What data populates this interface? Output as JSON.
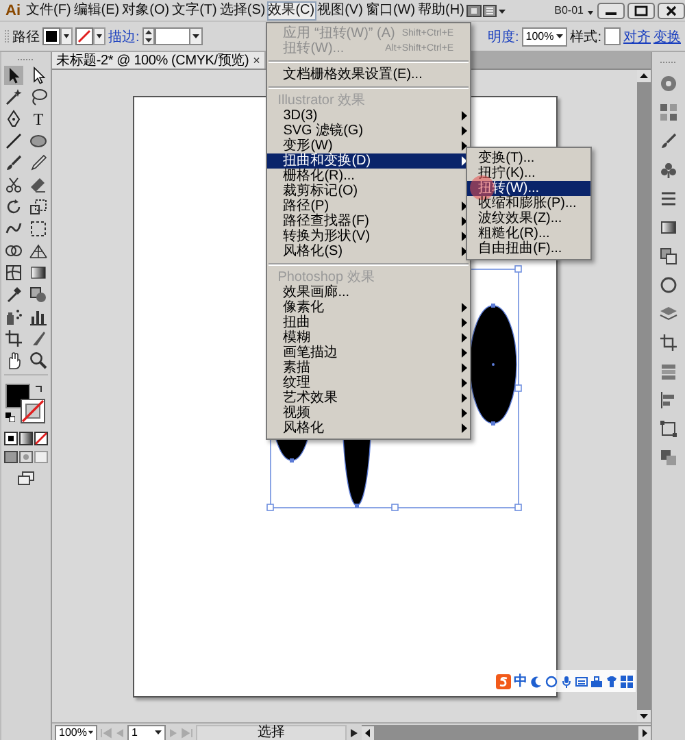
{
  "menubar": {
    "logo": "Ai",
    "menus": [
      {
        "label": "文件(F)",
        "selected": false
      },
      {
        "label": "编辑(E)",
        "selected": false
      },
      {
        "label": "对象(O)",
        "selected": false
      },
      {
        "label": "文字(T)",
        "selected": false
      },
      {
        "label": "选择(S)",
        "selected": false
      },
      {
        "label": "效果(C)",
        "selected": true
      },
      {
        "label": "视图(V)",
        "selected": false
      },
      {
        "label": "窗口(W)",
        "selected": false
      },
      {
        "label": "帮助(H)",
        "selected": false
      }
    ],
    "workspace": "B0-01"
  },
  "control_bar": {
    "object_type": "路径",
    "stroke_label": "描边:",
    "opacity_label": "明度:",
    "opacity_value": "100%",
    "style_label": "样式:",
    "links": [
      "对齐",
      "变换"
    ]
  },
  "effect_menu": {
    "items": [
      {
        "kind": "item",
        "label": "应用 “扭转(W)” (A)",
        "shortcut": "Shift+Ctrl+E",
        "disabled": true,
        "submenu": false,
        "selected": false
      },
      {
        "kind": "item",
        "label": "扭转(W)...",
        "shortcut": "Alt+Shift+Ctrl+E",
        "disabled": true,
        "submenu": false,
        "selected": false
      },
      {
        "kind": "separator"
      },
      {
        "kind": "item",
        "label": "文档栅格效果设置(E)...",
        "disabled": false,
        "submenu": false,
        "selected": false
      },
      {
        "kind": "separator"
      },
      {
        "kind": "header",
        "label": "Illustrator 效果"
      },
      {
        "kind": "item",
        "label": "3D(3)",
        "disabled": false,
        "submenu": true,
        "selected": false
      },
      {
        "kind": "item",
        "label": "SVG 滤镜(G)",
        "disabled": false,
        "submenu": true,
        "selected": false
      },
      {
        "kind": "item",
        "label": "变形(W)",
        "disabled": false,
        "submenu": true,
        "selected": false
      },
      {
        "kind": "item",
        "label": "扭曲和变换(D)",
        "disabled": false,
        "submenu": true,
        "selected": true
      },
      {
        "kind": "item",
        "label": "栅格化(R)...",
        "disabled": false,
        "submenu": false,
        "selected": false
      },
      {
        "kind": "item",
        "label": "裁剪标记(O)",
        "disabled": false,
        "submenu": false,
        "selected": false
      },
      {
        "kind": "item",
        "label": "路径(P)",
        "disabled": false,
        "submenu": true,
        "selected": false
      },
      {
        "kind": "item",
        "label": "路径查找器(F)",
        "disabled": false,
        "submenu": true,
        "selected": false
      },
      {
        "kind": "item",
        "label": "转换为形状(V)",
        "disabled": false,
        "submenu": true,
        "selected": false
      },
      {
        "kind": "item",
        "label": "风格化(S)",
        "disabled": false,
        "submenu": true,
        "selected": false
      },
      {
        "kind": "separator"
      },
      {
        "kind": "header",
        "label": "Photoshop 效果"
      },
      {
        "kind": "item",
        "label": "效果画廊...",
        "disabled": false,
        "submenu": false,
        "selected": false
      },
      {
        "kind": "item",
        "label": "像素化",
        "disabled": false,
        "submenu": true,
        "selected": false
      },
      {
        "kind": "item",
        "label": "扭曲",
        "disabled": false,
        "submenu": true,
        "selected": false
      },
      {
        "kind": "item",
        "label": "模糊",
        "disabled": false,
        "submenu": true,
        "selected": false
      },
      {
        "kind": "item",
        "label": "画笔描边",
        "disabled": false,
        "submenu": true,
        "selected": false
      },
      {
        "kind": "item",
        "label": "素描",
        "disabled": false,
        "submenu": true,
        "selected": false
      },
      {
        "kind": "item",
        "label": "纹理",
        "disabled": false,
        "submenu": true,
        "selected": false
      },
      {
        "kind": "item",
        "label": "艺术效果",
        "disabled": false,
        "submenu": true,
        "selected": false
      },
      {
        "kind": "item",
        "label": "视频",
        "disabled": false,
        "submenu": true,
        "selected": false
      },
      {
        "kind": "item",
        "label": "风格化",
        "disabled": false,
        "submenu": true,
        "selected": false
      }
    ]
  },
  "submenu": {
    "items": [
      {
        "label": "变换(T)...",
        "selected": false
      },
      {
        "label": "扭拧(K)...",
        "selected": false
      },
      {
        "label": "扭转(W)...",
        "selected": true
      },
      {
        "label": "收缩和膨胀(P)...",
        "selected": false
      },
      {
        "label": "波纹效果(Z)...",
        "selected": false
      },
      {
        "label": "粗糙化(R)...",
        "selected": false
      },
      {
        "label": "自由扭曲(F)...",
        "selected": false
      }
    ]
  },
  "toolbox": {
    "type_tool": "T"
  },
  "document_tab": {
    "title": "未标题-2* @ 100% (CMYK/预览)",
    "close": "×"
  },
  "ime_bar": {
    "mode": "中"
  },
  "status_bar": {
    "zoom": "100%",
    "page": "1",
    "tool": "选择"
  }
}
